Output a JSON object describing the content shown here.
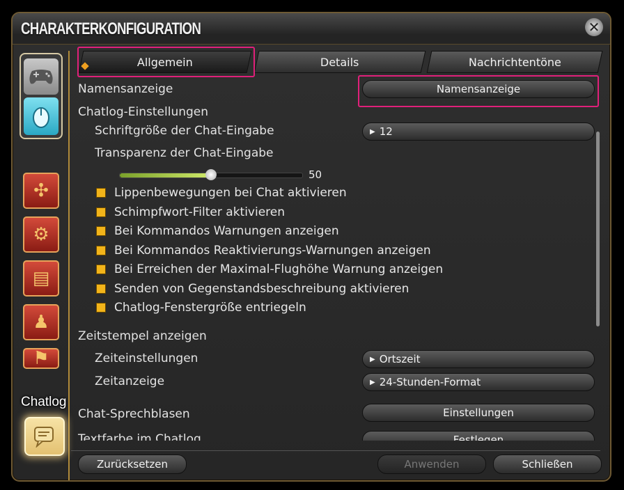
{
  "window": {
    "title": "CHARAKTERKONFIGURATION"
  },
  "sidebar": {
    "tooltip": "Chatlog",
    "icons": [
      "gamepad-icon",
      "mouse-icon",
      "crossed-arrows-icon",
      "gear-bag-icon",
      "id-card-icon",
      "character-card-icon",
      "flag-icon",
      "chat-bubble-icon"
    ]
  },
  "tabs": [
    {
      "label": "Allgemein",
      "active": true
    },
    {
      "label": "Details",
      "active": false
    },
    {
      "label": "Nachrichtentöne",
      "active": false
    }
  ],
  "settings": {
    "namensanzeige_label": "Namensanzeige",
    "namensanzeige_button": "Namensanzeige",
    "chatlog_section": "Chatlog-Einstellungen",
    "font_size_label": "Schriftgröße der Chat-Eingabe",
    "font_size_value": "12",
    "transparency_label": "Transparenz der Chat-Eingabe",
    "transparency_value": "50",
    "checkboxes": [
      {
        "label": "Lippenbewegungen bei Chat aktivieren",
        "checked": true
      },
      {
        "label": "Schimpfwort-Filter aktivieren",
        "checked": true
      },
      {
        "label": "Bei Kommandos Warnungen anzeigen",
        "checked": true
      },
      {
        "label": "Bei Kommandos Reaktivierungs-Warnungen anzeigen",
        "checked": true
      },
      {
        "label": "Bei Erreichen der Maximal-Flughöhe Warnung anzeigen",
        "checked": true
      },
      {
        "label": "Senden von Gegenstandsbeschreibung aktivieren",
        "checked": true
      },
      {
        "label": "Chatlog-Fenstergröße entriegeln",
        "checked": true
      }
    ],
    "timestamp_section": "Zeitstempel anzeigen",
    "time_settings_label": "Zeiteinstellungen",
    "time_settings_value": "Ortszeit",
    "time_display_label": "Zeitanzeige",
    "time_display_value": "24-Stunden-Format",
    "bubbles_label": "Chat-Sprechblasen",
    "bubbles_button": "Einstellungen",
    "textcolor_label": "Textfarbe im Chatlog",
    "textcolor_button": "Festlegen"
  },
  "footer": {
    "reset": "Zurücksetzen",
    "apply": "Anwenden",
    "close": "Schließen"
  },
  "colors": {
    "highlight": "#e0207a",
    "checkbox": "#f2b41a",
    "accent": "#b08a3a"
  }
}
